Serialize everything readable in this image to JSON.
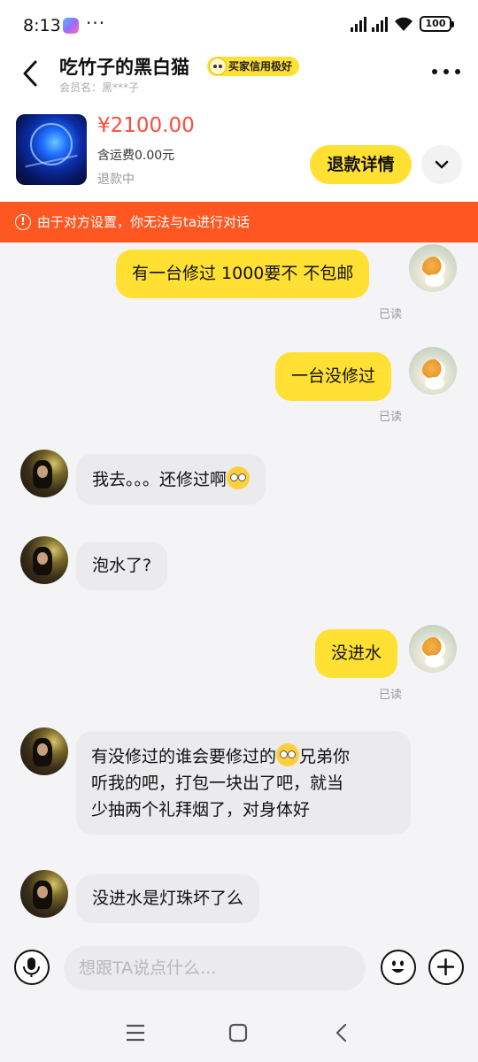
{
  "status_bar": {
    "time": "8:13",
    "dots": "···",
    "battery": "100"
  },
  "header": {
    "title": "吃竹子的黑白猫",
    "credit_badge": "买家信用极好",
    "member": "会员名：黑***子"
  },
  "product": {
    "price": "¥2100.00",
    "shipping": "含运费0.00元",
    "status": "退款中",
    "refund_button": "退款详情"
  },
  "warning": {
    "text": "由于对方设置，你无法与ta进行对话"
  },
  "messages": [
    {
      "side": "out",
      "text": "有一台修过  1000要不 不包邮",
      "status": "已读"
    },
    {
      "side": "out",
      "text": "一台没修过",
      "status": "已读"
    },
    {
      "side": "in",
      "text": "我去。。。还修过啊"
    },
    {
      "side": "in",
      "text": "泡水了?"
    },
    {
      "side": "out",
      "text": "没进水",
      "status": "已读"
    },
    {
      "side": "in",
      "line1": "有没修过的谁会要修过的",
      "line1b": "兄弟你",
      "line2": "听我的吧，打包一块出了吧，就当",
      "line3": "少抽两个礼拜烟了，对身体好"
    },
    {
      "side": "in",
      "text": "没进水是灯珠坏了么"
    }
  ],
  "input": {
    "placeholder": "想跟TA说点什么..."
  },
  "colors": {
    "accent_yellow": "#ffe033",
    "warning_orange": "#ff5722",
    "price_red": "#ff4b3e"
  },
  "icons": [
    "back-icon",
    "more-icon",
    "chevron-down-icon",
    "warning-icon",
    "microphone-icon",
    "emoji-icon",
    "plus-icon",
    "menu-icon",
    "home-icon",
    "back-nav-icon"
  ]
}
